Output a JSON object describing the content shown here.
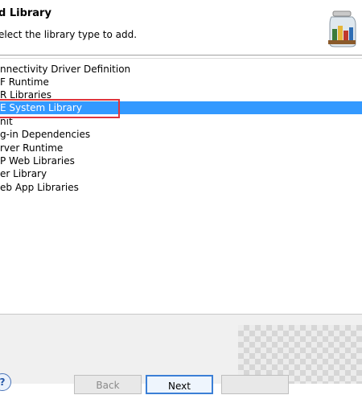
{
  "dialog": {
    "title": "d Library",
    "description": "elect the library type to add.",
    "icon": "library-books-jar-icon"
  },
  "library_types": [
    {
      "label": "nnectivity Driver Definition",
      "selected": false
    },
    {
      "label": "F Runtime",
      "selected": false
    },
    {
      "label": "R Libraries",
      "selected": false
    },
    {
      "label": "E System Library",
      "selected": true
    },
    {
      "label": "nit",
      "selected": false
    },
    {
      "label": "g-in Dependencies",
      "selected": false
    },
    {
      "label": "rver Runtime",
      "selected": false
    },
    {
      "label": "P Web Libraries",
      "selected": false
    },
    {
      "label": "er Library",
      "selected": false
    },
    {
      "label": "eb App Libraries",
      "selected": false
    }
  ],
  "buttons": {
    "help_label": "?",
    "back_label": "Back",
    "next_label": "Next",
    "finish_label": ""
  },
  "colors": {
    "selection": "#3399ff",
    "highlight_box": "#e0343c"
  }
}
